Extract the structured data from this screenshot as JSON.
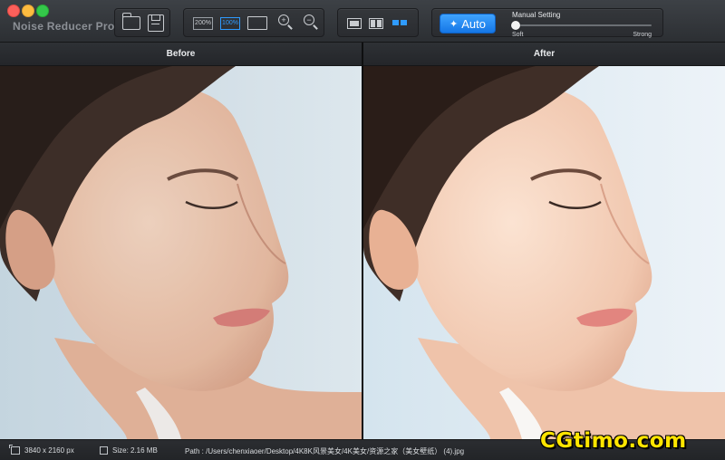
{
  "window": {
    "title": "Noise Reducer Pro",
    "traffic_lights": {
      "close": "#fc605b",
      "minimize": "#fdbc40",
      "zoom": "#34c84a"
    }
  },
  "toolbar": {
    "file_buttons": [
      {
        "icon": "folder-open-icon"
      },
      {
        "icon": "save-icon"
      }
    ],
    "zoom": {
      "zoom_200_label": "200%",
      "zoom_100_label": "100%",
      "fit_icon": "fit-to-window-icon",
      "zoom_in_icon": "zoom-in-icon",
      "zoom_out_icon": "zoom-out-icon",
      "active": "100%"
    },
    "view_modes": [
      {
        "icon": "single-view-icon",
        "selected": false
      },
      {
        "icon": "split-view-icon",
        "selected": false
      },
      {
        "icon": "side-by-side-view-icon",
        "selected": true
      }
    ],
    "auto_label": "Auto",
    "manual_setting_label": "Manual Setting",
    "slider": {
      "min_label": "Soft",
      "max_label": "Strong",
      "value": 0
    },
    "accent_color": "#2f9bff"
  },
  "panels": {
    "before_label": "Before",
    "after_label": "After"
  },
  "status": {
    "dimensions": "3840 x 2160 px",
    "size": "Size: 2.16 MB",
    "path": "Path : /Users/chenxiaoer/Desktop/4K8K风景美女/4K美女/资源之家（美女壁纸） (4).jpg"
  },
  "watermark": "CGtimo.com"
}
